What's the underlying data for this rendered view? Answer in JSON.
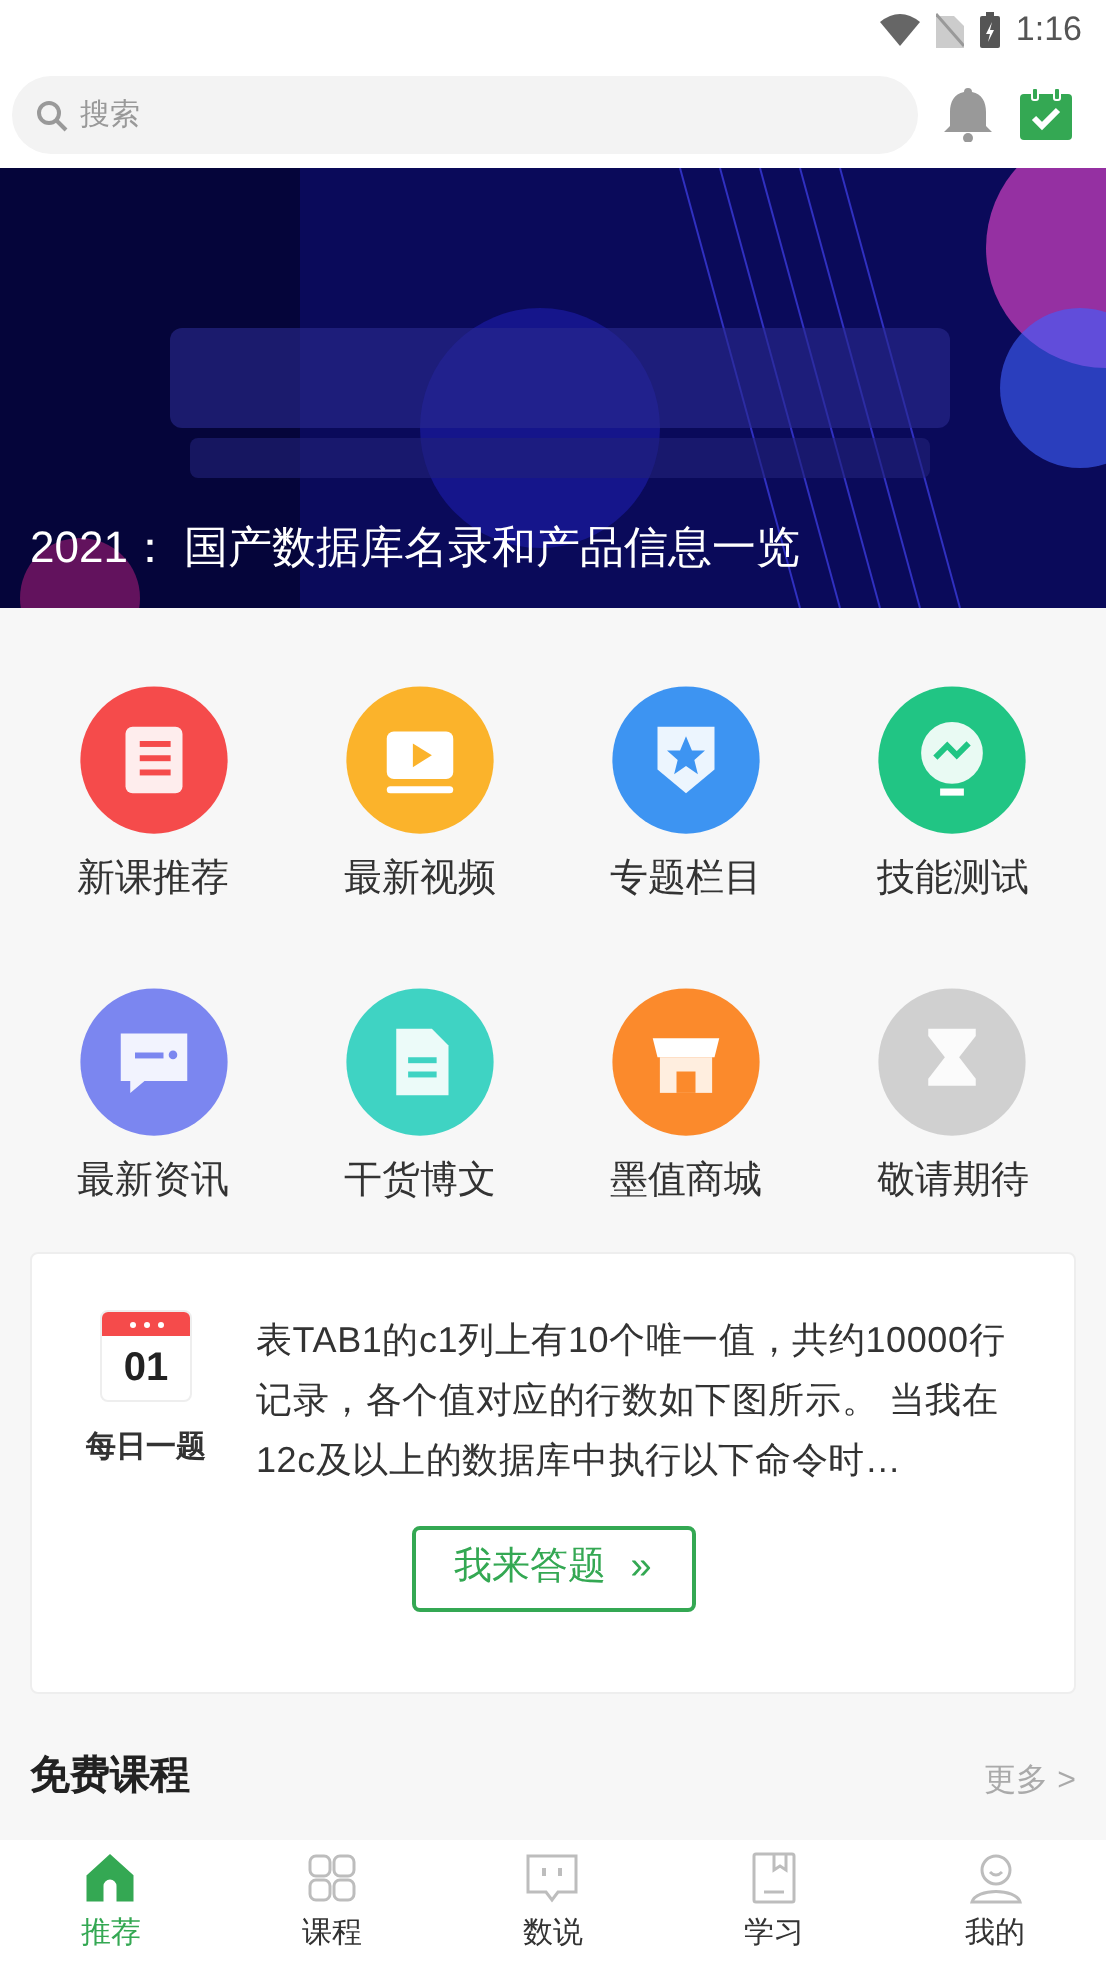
{
  "status_bar": {
    "time": "1:16"
  },
  "search": {
    "placeholder": "搜索"
  },
  "banner": {
    "kind": "picture",
    "caption": "2021： 国产数据库名录和产品信息一览"
  },
  "shortcuts": [
    {
      "label": "新课推荐",
      "kind": "book",
      "color": "#f54b4b"
    },
    {
      "label": "最新视频",
      "kind": "video",
      "color": "#fbb32b"
    },
    {
      "label": "专题栏目",
      "kind": "star",
      "color": "#3d94f2"
    },
    {
      "label": "技能测试",
      "kind": "bulb",
      "color": "#21c584"
    },
    {
      "label": "最新资讯",
      "kind": "chat",
      "color": "#7b86f0"
    },
    {
      "label": "干货博文",
      "kind": "doc",
      "color": "#3fd3c3"
    },
    {
      "label": "墨值商城",
      "kind": "shop",
      "color": "#fb8a2c"
    },
    {
      "label": "敬请期待",
      "kind": "hourglass",
      "color": "#d0d0d0"
    }
  ],
  "daily": {
    "day": "01",
    "label": "每日一题",
    "question": "表TAB1的c1列上有10个唯一值，共约10000行记录，各个值对应的行数如下图所示。 当我在12c及以上的数据库中执行以下命令时…",
    "button": "我来答题",
    "button_icon": "»"
  },
  "section": {
    "title": "免费课程",
    "more": "更多 >"
  },
  "tabs": [
    {
      "label": "推荐",
      "kind": "home",
      "selected": true
    },
    {
      "label": "课程",
      "kind": "grid",
      "selected": false
    },
    {
      "label": "数说",
      "kind": "talk",
      "selected": false
    },
    {
      "label": "学习",
      "kind": "notebook",
      "selected": false
    },
    {
      "label": "我的",
      "kind": "user",
      "selected": false
    }
  ]
}
